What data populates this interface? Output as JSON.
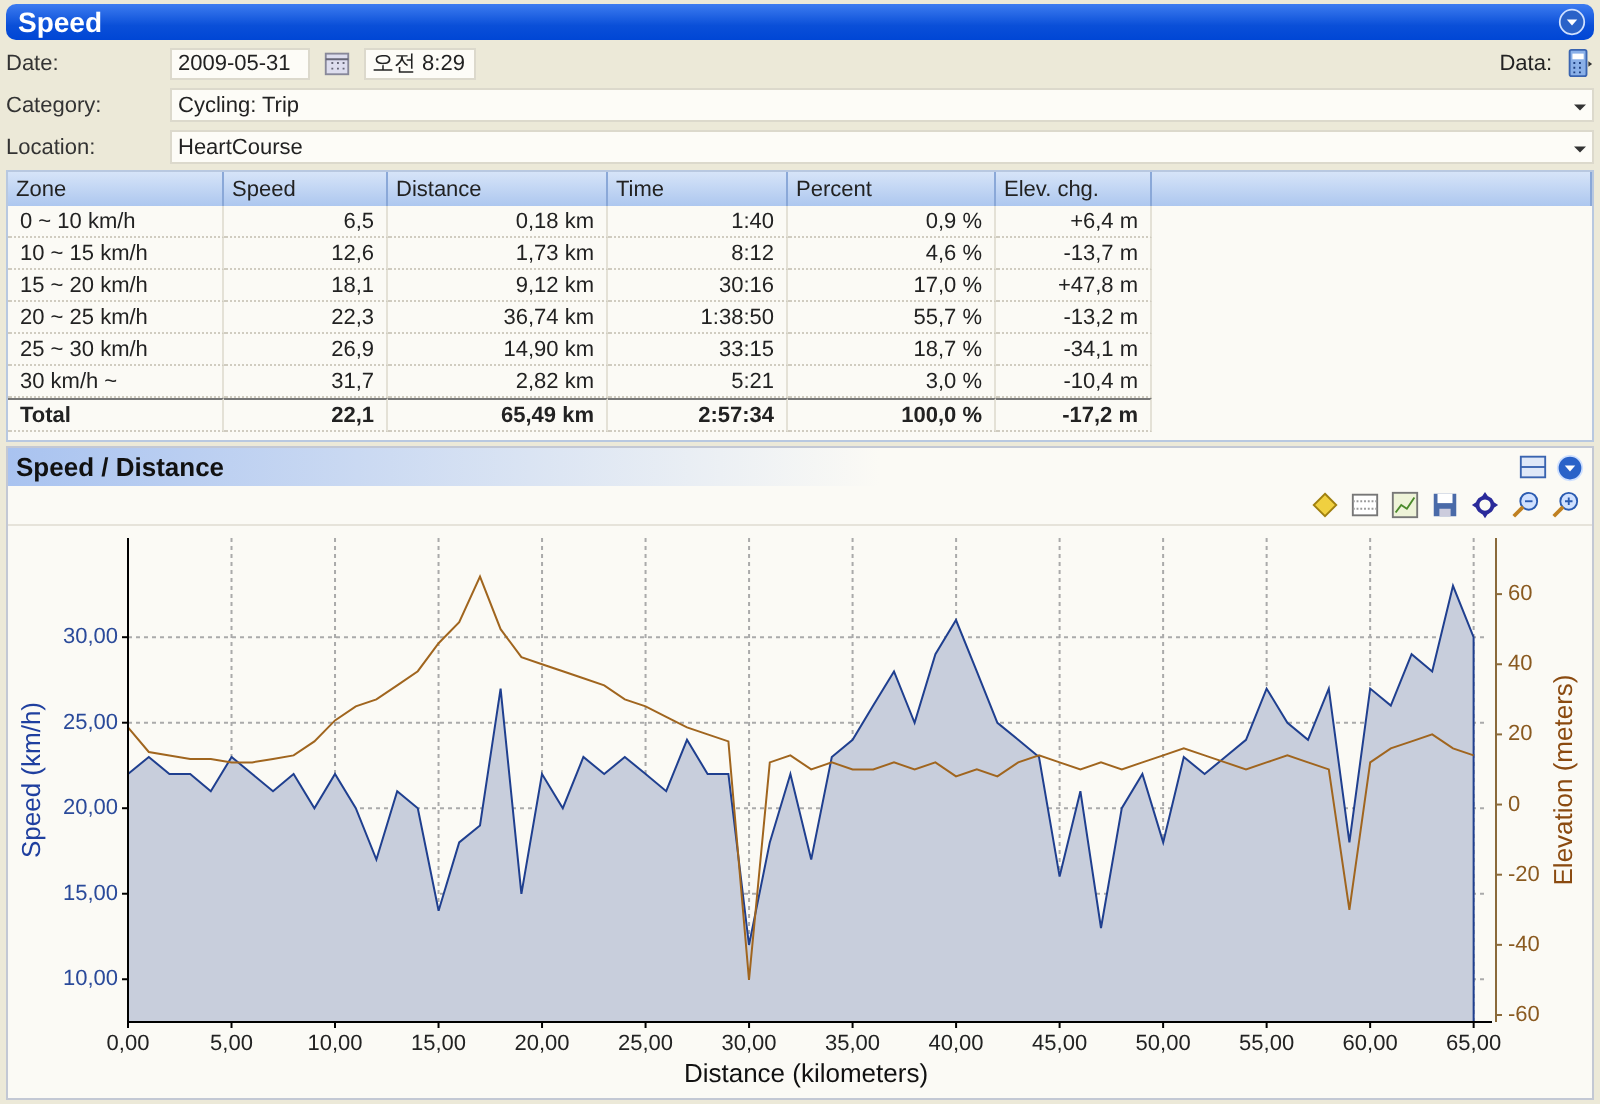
{
  "window": {
    "title": "Speed"
  },
  "form": {
    "date_label": "Date:",
    "date": "2009-05-31",
    "time": "오전 8:29",
    "data_label": "Data:",
    "category_label": "Category:",
    "category": "Cycling: Trip",
    "location_label": "Location:",
    "location": "HeartCourse"
  },
  "table": {
    "columns": [
      "Zone",
      "Speed",
      "Distance",
      "Time",
      "Percent",
      "Elev. chg."
    ],
    "rows": [
      [
        "0 ~ 10 km/h",
        "6,5",
        "0,18 km",
        "1:40",
        "0,9 %",
        "+6,4 m"
      ],
      [
        "10 ~ 15 km/h",
        "12,6",
        "1,73 km",
        "8:12",
        "4,6 %",
        "-13,7 m"
      ],
      [
        "15 ~ 20 km/h",
        "18,1",
        "9,12 km",
        "30:16",
        "17,0 %",
        "+47,8 m"
      ],
      [
        "20 ~ 25 km/h",
        "22,3",
        "36,74 km",
        "1:38:50",
        "55,7 %",
        "-13,2 m"
      ],
      [
        "25 ~ 30 km/h",
        "26,9",
        "14,90 km",
        "33:15",
        "18,7 %",
        "-34,1 m"
      ],
      [
        "30 km/h ~",
        "31,7",
        "2,82 km",
        "5:21",
        "3,0 %",
        "-10,4 m"
      ]
    ],
    "total": [
      "Total",
      "22,1",
      "65,49 km",
      "2:57:34",
      "100,0 %",
      "-17,2 m"
    ]
  },
  "chart_panel": {
    "title": "Speed / Distance",
    "chart_data": {
      "type": "area",
      "xlabel": "Distance (kilometers)",
      "ylabel": "Speed (km/h)",
      "y2label": "Elevation (meters)",
      "x": [
        0,
        1,
        2,
        3,
        4,
        5,
        6,
        7,
        8,
        9,
        10,
        11,
        12,
        13,
        14,
        15,
        16,
        17,
        18,
        19,
        20,
        21,
        22,
        23,
        24,
        25,
        26,
        27,
        28,
        29,
        30,
        31,
        32,
        33,
        34,
        35,
        36,
        37,
        38,
        39,
        40,
        41,
        42,
        43,
        44,
        45,
        46,
        47,
        48,
        49,
        50,
        51,
        52,
        53,
        54,
        55,
        56,
        57,
        58,
        59,
        60,
        61,
        62,
        63,
        64,
        65
      ],
      "series": [
        {
          "color": "#1f3f8f",
          "values": [
            22,
            23,
            22,
            22,
            21,
            23,
            22,
            21,
            22,
            20,
            22,
            20,
            17,
            21,
            20,
            14,
            18,
            19,
            27,
            15,
            22,
            20,
            23,
            22,
            23,
            22,
            21,
            24,
            22,
            22,
            12,
            18,
            22,
            17,
            23,
            24,
            26,
            28,
            25,
            29,
            31,
            28,
            25,
            24,
            23,
            16,
            21,
            13,
            20,
            22,
            18,
            23,
            22,
            23,
            24,
            27,
            25,
            24,
            27,
            18,
            27,
            26,
            29,
            28,
            33,
            30
          ]
        },
        {
          "color": "#a0651e",
          "axis": "y2",
          "type": "line",
          "values": [
            22,
            15,
            14,
            13,
            13,
            12,
            12,
            13,
            14,
            18,
            24,
            28,
            30,
            34,
            38,
            46,
            52,
            65,
            50,
            42,
            40,
            38,
            36,
            34,
            30,
            28,
            25,
            22,
            20,
            18,
            -50,
            12,
            14,
            10,
            12,
            10,
            10,
            12,
            10,
            12,
            8,
            10,
            8,
            12,
            14,
            12,
            10,
            12,
            10,
            12,
            14,
            16,
            14,
            12,
            10,
            12,
            14,
            12,
            10,
            -30,
            12,
            16,
            18,
            20,
            16,
            14
          ]
        }
      ],
      "grid": true,
      "xlim": [
        0,
        65.5
      ],
      "ylim": [
        7.5,
        35.8
      ],
      "y2lim": [
        -62,
        76
      ],
      "xticks": [
        {
          "value": 0,
          "label": "0,00"
        },
        {
          "value": 5,
          "label": "5,00"
        },
        {
          "value": 10,
          "label": "10,00"
        },
        {
          "value": 15,
          "label": "15,00"
        },
        {
          "value": 20,
          "label": "20,00"
        },
        {
          "value": 25,
          "label": "25,00"
        },
        {
          "value": 30,
          "label": "30,00"
        },
        {
          "value": 35,
          "label": "35,00"
        },
        {
          "value": 40,
          "label": "40,00"
        },
        {
          "value": 45,
          "label": "45,00"
        },
        {
          "value": 50,
          "label": "50,00"
        },
        {
          "value": 55,
          "label": "55,00"
        },
        {
          "value": 60,
          "label": "60,00"
        },
        {
          "value": 65,
          "label": "65,00"
        }
      ],
      "yticks": [
        {
          "value": 10,
          "label": "10,00"
        },
        {
          "value": 15,
          "label": "15,00"
        },
        {
          "value": 20,
          "label": "20,00"
        },
        {
          "value": 25,
          "label": "25,00"
        },
        {
          "value": 30,
          "label": "30,00"
        }
      ],
      "y2ticks": [
        -60,
        -40,
        -20,
        0,
        20,
        40,
        60
      ]
    }
  }
}
